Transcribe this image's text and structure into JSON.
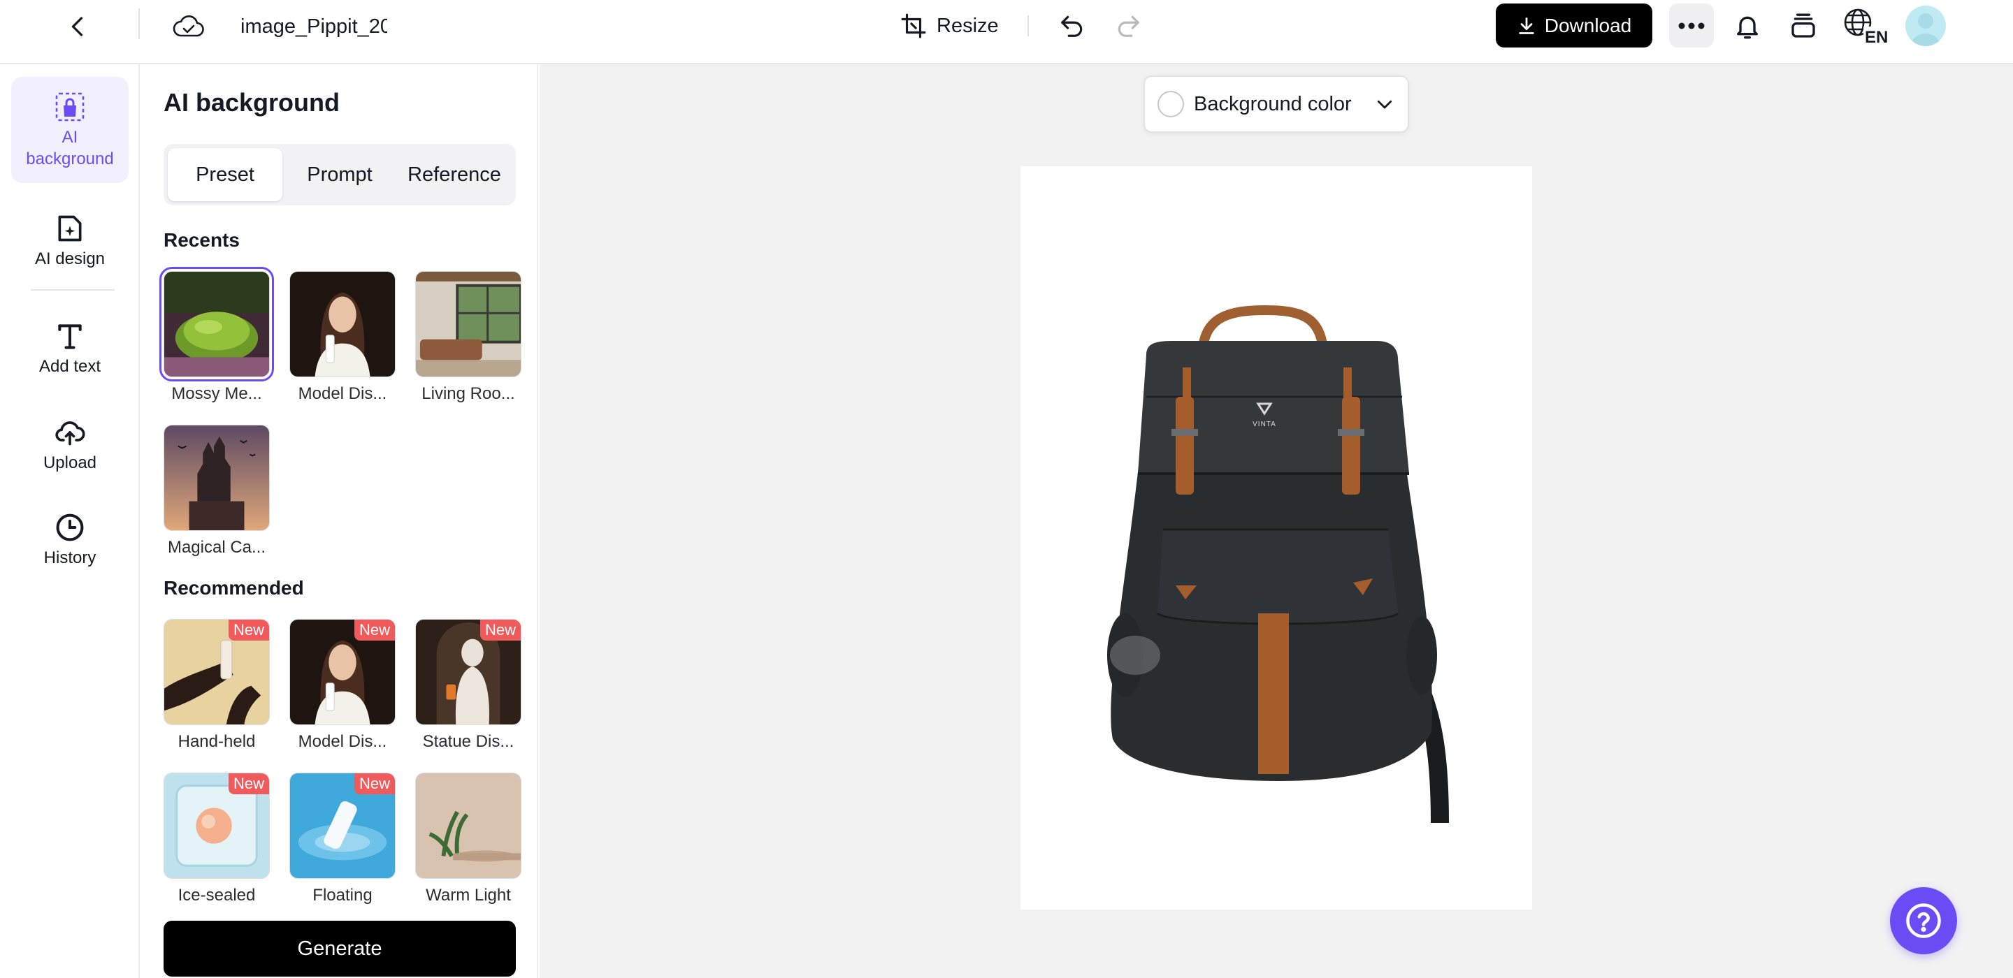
{
  "topbar": {
    "file_name": "image_Pippit_20",
    "resize_label": "Resize",
    "download_label": "Download",
    "lang_code": "EN"
  },
  "rail": {
    "items": [
      {
        "label": "AI background",
        "icon": "ai-background-icon",
        "active": true
      },
      {
        "label": "AI design",
        "icon": "ai-design-icon"
      },
      {
        "label": "Add text",
        "icon": "text-icon"
      },
      {
        "label": "Upload",
        "icon": "upload-cloud-icon"
      },
      {
        "label": "History",
        "icon": "clock-icon"
      }
    ]
  },
  "panel": {
    "title": "AI background",
    "tabs": [
      {
        "label": "Preset",
        "active": true
      },
      {
        "label": "Prompt"
      },
      {
        "label": "Reference"
      }
    ],
    "recents_heading": "Recents",
    "recents": [
      {
        "label": "Mossy Me...",
        "selected": true
      },
      {
        "label": "Model Dis..."
      },
      {
        "label": "Living Roo..."
      },
      {
        "label": "Magical Ca..."
      }
    ],
    "recommended_heading": "Recommended",
    "recommended": [
      {
        "label": "Hand-held",
        "badge": "New"
      },
      {
        "label": "Model Dis...",
        "badge": "New"
      },
      {
        "label": "Statue Dis...",
        "badge": "New"
      },
      {
        "label": "Ice-sealed",
        "badge": "New"
      },
      {
        "label": "Floating",
        "badge": "New"
      },
      {
        "label": "Warm Light"
      }
    ],
    "generate_label": "Generate"
  },
  "canvas": {
    "bg_color_label": "Background color",
    "logo_text": "VINTA"
  },
  "colors": {
    "accent": "#6a4cf5",
    "badge_new": "#f05a5a",
    "primary_button": "#000000",
    "canvas_bg": "#f2f2f3"
  }
}
